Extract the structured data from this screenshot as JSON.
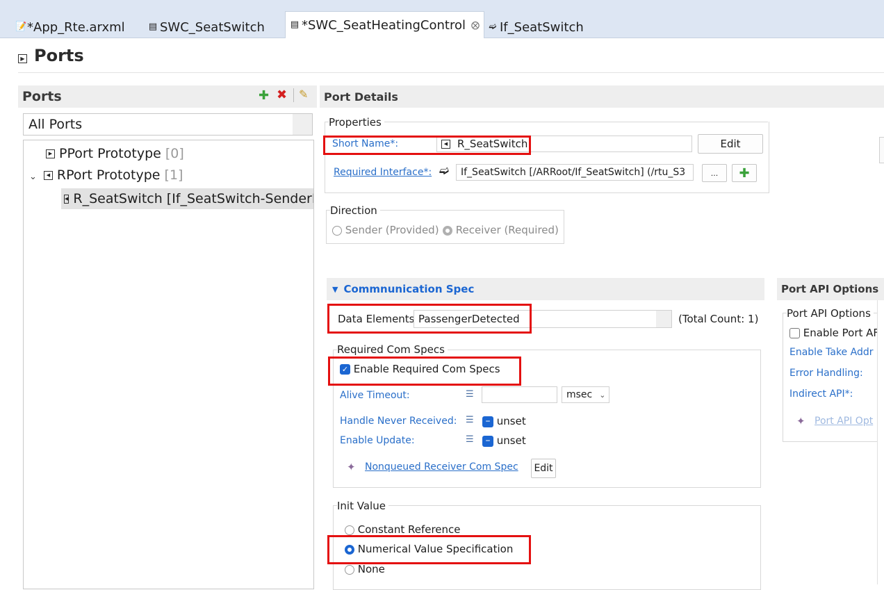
{
  "tabs": [
    {
      "label": "*App_Rte.arxml",
      "icon": "arxml-file-icon"
    },
    {
      "label": "SWC_SeatSwitch",
      "icon": "component-icon"
    },
    {
      "label": "*SWC_SeatHeatingControl",
      "icon": "component-icon",
      "active": true
    },
    {
      "label": "If_SeatSwitch",
      "icon": "interface-icon"
    }
  ],
  "page_title": "Ports",
  "ports_panel": {
    "title": "Ports",
    "filter": "All Ports",
    "tree": [
      {
        "label": "PPort Prototype",
        "count": "[0]"
      },
      {
        "label": "RPort Prototype",
        "count": "[1]",
        "expanded": true,
        "children": [
          {
            "label": "R_SeatSwitch [If_SeatSwitch-SenderRe"
          }
        ]
      }
    ]
  },
  "port_details": {
    "title": "Port Details",
    "properties": {
      "group": "Properties",
      "short_name_label": "Short Name*:",
      "short_name_value": "R_SeatSwitch",
      "edit_label": "Edit",
      "required_interface_label": "Required Interface*:",
      "required_interface_value": "If_SeatSwitch [/ARRoot/If_SeatSwitch] (/rtu_S3",
      "browse_label": "..."
    },
    "direction": {
      "group": "Direction",
      "sender": "Sender (Provided)",
      "receiver": "Receiver (Required)"
    },
    "comm_spec": {
      "title": "Commnunication Spec",
      "data_elements_label": "Data Elements",
      "data_elements_value": "PassengerDetected",
      "total_count": "(Total Count: 1)",
      "required_com_specs_group": "Required Com Specs",
      "enable_required_label": "Enable Required Com Specs",
      "alive_timeout_label": "Alive Timeout:",
      "alive_timeout_value": "",
      "unit": "msec",
      "handle_never_received_label": "Handle Never Received:",
      "handle_never_received_value": "unset",
      "enable_update_label": "Enable Update:",
      "enable_update_value": "unset",
      "nonqueued_link": "Nonqueued Receiver Com Spec",
      "nonqueued_edit": "Edit"
    },
    "init_value": {
      "group": "Init Value",
      "options": [
        "Constant Reference",
        "Numerical Value Specification",
        "None"
      ],
      "selected": "Numerical Value Specification"
    }
  },
  "port_api": {
    "title": "Port API Options",
    "group": "Port API Options",
    "enable_port": "Enable Port AF",
    "enable_take": "Enable Take Addr",
    "error_handling": "Error Handling:",
    "indirect_api": "Indirect API*:",
    "link": "Port API Opt"
  },
  "colors": {
    "accent": "#1b66d2",
    "link": "#2a6fc9",
    "highlight": "#e41010"
  }
}
